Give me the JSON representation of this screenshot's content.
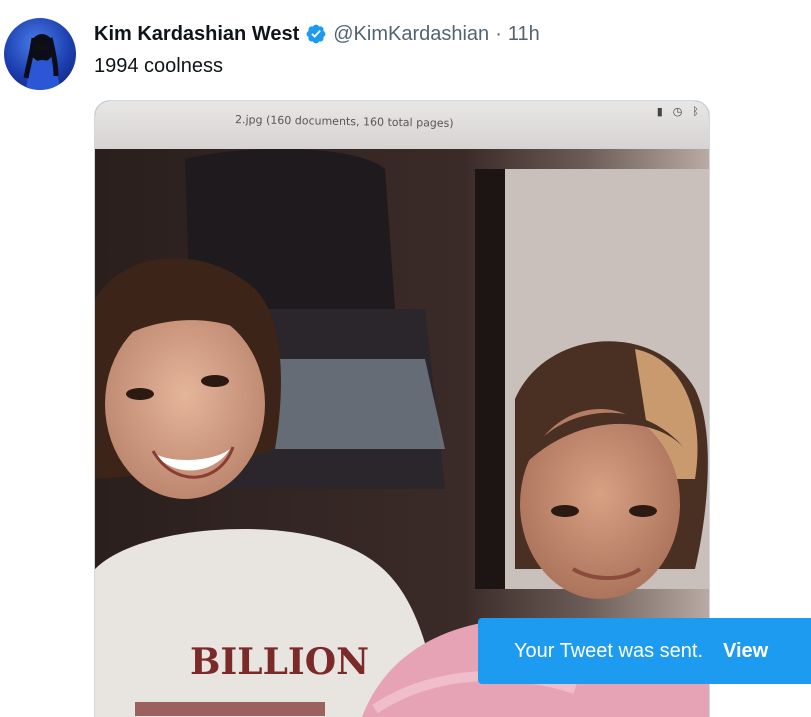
{
  "tweet": {
    "author_name": "Kim Kardashian West",
    "handle": "@KimKardashian",
    "separator": "·",
    "time": "11h",
    "text": "1994 coolness",
    "verified_color": "#1d9bf0"
  },
  "media": {
    "screen_window_title": "2.jpg (160 documents, 160 total pages)",
    "shirt_text": "BILLION"
  },
  "toast": {
    "message": "Your Tweet was sent.",
    "action": "View",
    "background": "#1d9bf0"
  }
}
